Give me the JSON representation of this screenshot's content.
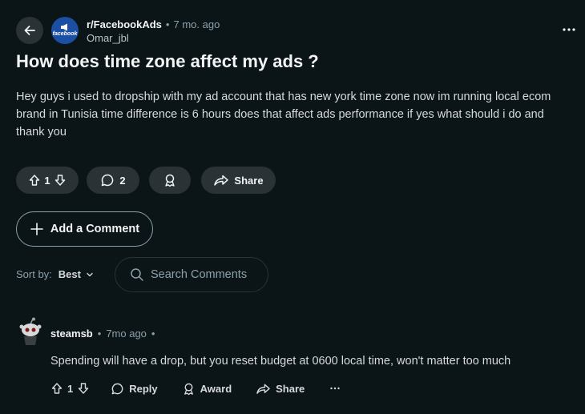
{
  "post": {
    "subreddit": "r/FacebookAds",
    "time_ago": "7 mo. ago",
    "author": "Omar_jbl",
    "subreddit_avatar_text": "facebook",
    "title": "How does time zone affect my ads ?",
    "body": "Hey guys i used to dropship with my ad account that has new york time zone now im running local ecom brand in Tunisia time difference is 6 hours does that affect ads performance if yes what should i do and thank you",
    "vote_count": "1",
    "comment_count": "2",
    "share_label": "Share"
  },
  "add_comment_label": "Add a Comment",
  "sort": {
    "label": "Sort by:",
    "value": "Best"
  },
  "search": {
    "placeholder": "Search Comments"
  },
  "comment": {
    "author": "steamsb",
    "time_ago": "7mo ago",
    "body": "Spending will have a drop, but you reset budget at 0600 local time, won't matter too much",
    "vote_count": "1",
    "reply_label": "Reply",
    "award_label": "Award",
    "share_label": "Share"
  },
  "colors": {
    "background": "#0b1416",
    "pill": "#2a3236",
    "muted_text": "#8ba2ad",
    "subreddit_avatar": "#1b4fa3"
  }
}
